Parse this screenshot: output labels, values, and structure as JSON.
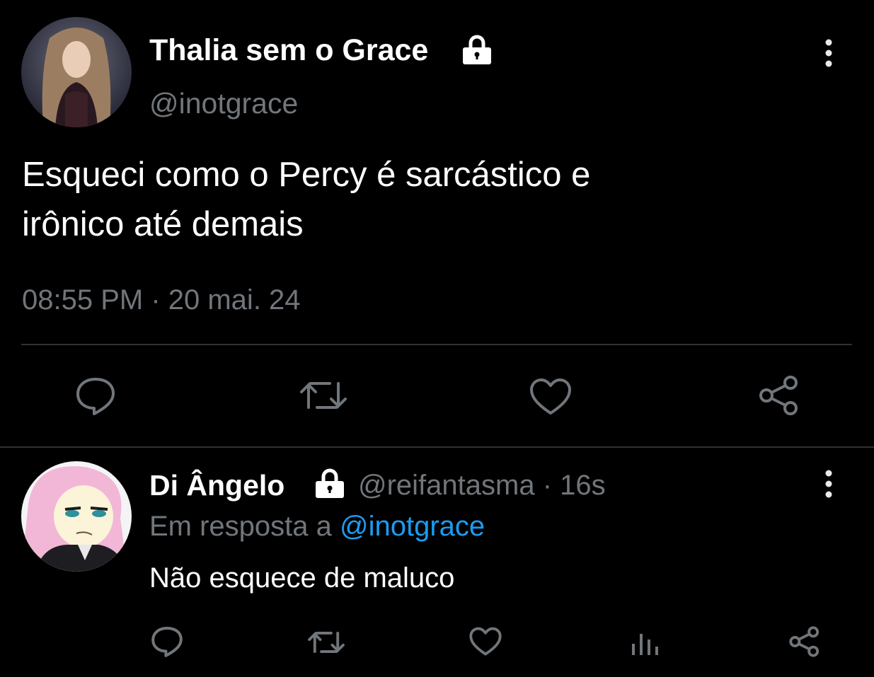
{
  "main_tweet": {
    "author": {
      "display_name": "Thalia sem o Grace",
      "handle": "@inotgrace",
      "protected_icon": "lock-icon",
      "avatar_icon": "profile-photo"
    },
    "text_line1": "Esqueci como o Percy é sarcástico e",
    "text_line2": "irônico até demais",
    "timestamp": "08:55 PM · 20 mai. 24",
    "more_icon": "more-vertical-icon",
    "actions": [
      "reply-icon",
      "retweet-icon",
      "like-icon",
      "share-icon"
    ]
  },
  "reply": {
    "author": {
      "display_name": "Di Ângelo",
      "handle": "@reifantasma",
      "separator": " · ",
      "time_ago": "16s",
      "protected_icon": "lock-icon",
      "avatar_icon": "profile-photo"
    },
    "in_reply_prefix": "Em resposta a ",
    "in_reply_mention": "@inotgrace",
    "text": "Não esquece de maluco",
    "more_icon": "more-vertical-icon",
    "actions": [
      "reply-icon",
      "retweet-icon",
      "like-icon",
      "analytics-icon",
      "share-icon"
    ]
  },
  "colors": {
    "background": "#000000",
    "primary_text": "#ffffff",
    "secondary_text": "#71767b",
    "accent": "#1d9bf0",
    "divider": "#2f3336"
  }
}
